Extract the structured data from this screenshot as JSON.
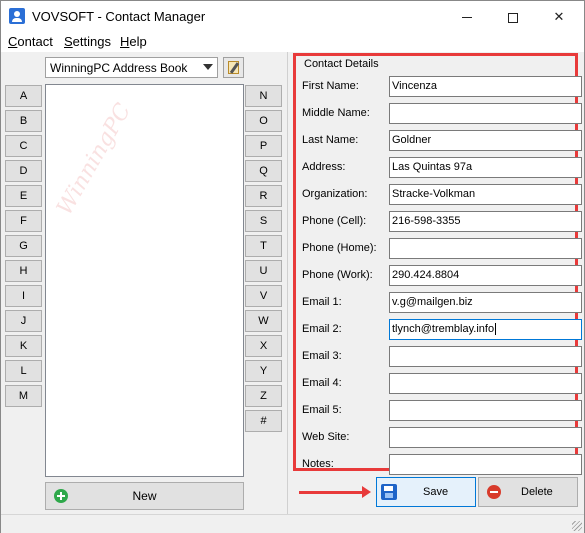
{
  "window": {
    "title": "VOVSOFT - Contact Manager",
    "minimize_glyph": "",
    "close_glyph": "✕"
  },
  "menu": [
    {
      "label": "Contact",
      "accel": "C",
      "rest": "ontact"
    },
    {
      "label": "Settings",
      "accel": "S",
      "rest": "ettings"
    },
    {
      "label": "Help",
      "accel": "H",
      "rest": "elp"
    }
  ],
  "address_book": {
    "selected": "WinningPC Address Book"
  },
  "letters_left": [
    "A",
    "B",
    "C",
    "D",
    "E",
    "F",
    "G",
    "H",
    "I",
    "J",
    "K",
    "L",
    "M"
  ],
  "letters_right": [
    "N",
    "O",
    "P",
    "Q",
    "R",
    "S",
    "T",
    "U",
    "V",
    "W",
    "X",
    "Y",
    "Z",
    "#"
  ],
  "new_button_label": "New",
  "details": {
    "group_title": "Contact Details",
    "fields": [
      {
        "label": "First Name:",
        "value": "Vincenza"
      },
      {
        "label": "Middle Name:",
        "value": ""
      },
      {
        "label": "Last Name:",
        "value": "Goldner"
      },
      {
        "label": "Address:",
        "value": "Las Quintas 97a"
      },
      {
        "label": "Organization:",
        "value": "Stracke-Volkman"
      },
      {
        "label": "Phone (Cell):",
        "value": "216-598-3355"
      },
      {
        "label": "Phone (Home):",
        "value": ""
      },
      {
        "label": "Phone (Work):",
        "value": "290.424.8804"
      },
      {
        "label": "Email 1:",
        "value": "v.g@mailgen.biz"
      },
      {
        "label": "Email 2:",
        "value": "tlynch@tremblay.info"
      },
      {
        "label": "Email 3:",
        "value": ""
      },
      {
        "label": "Email 4:",
        "value": ""
      },
      {
        "label": "Email 5:",
        "value": ""
      },
      {
        "label": "Web Site:",
        "value": ""
      },
      {
        "label": "Notes:",
        "value": ""
      }
    ],
    "focused_field_index": 9
  },
  "buttons": {
    "save": "Save",
    "delete": "Delete"
  },
  "colors": {
    "annotation_red": "#e83a3a",
    "focus_blue": "#0078d7"
  }
}
